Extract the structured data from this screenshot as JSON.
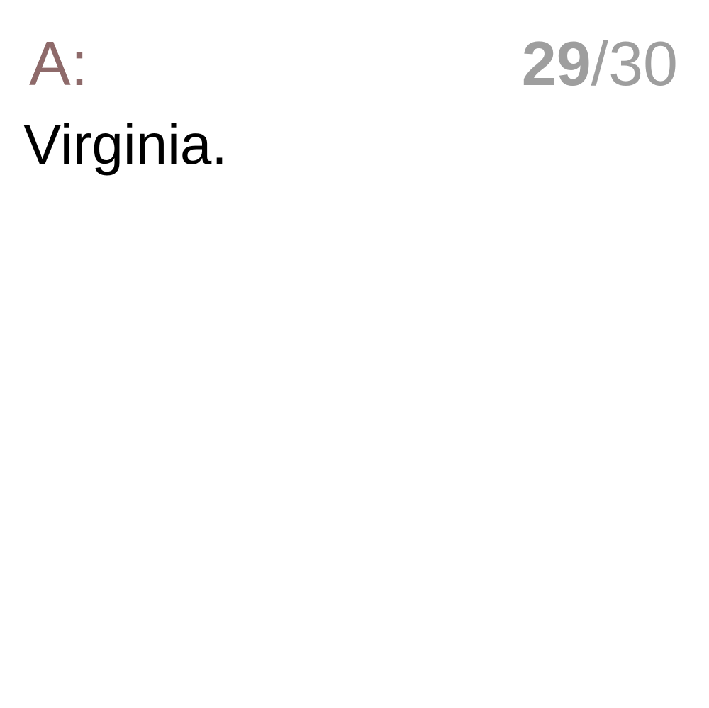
{
  "card": {
    "label": "A:",
    "answer": "Virginia.",
    "progress": {
      "current": "29",
      "separator": "/",
      "total": "30"
    }
  },
  "colors": {
    "label": "#8e6a6a",
    "counter": "#9e9e9e",
    "answer": "#000000",
    "background": "#ffffff"
  }
}
